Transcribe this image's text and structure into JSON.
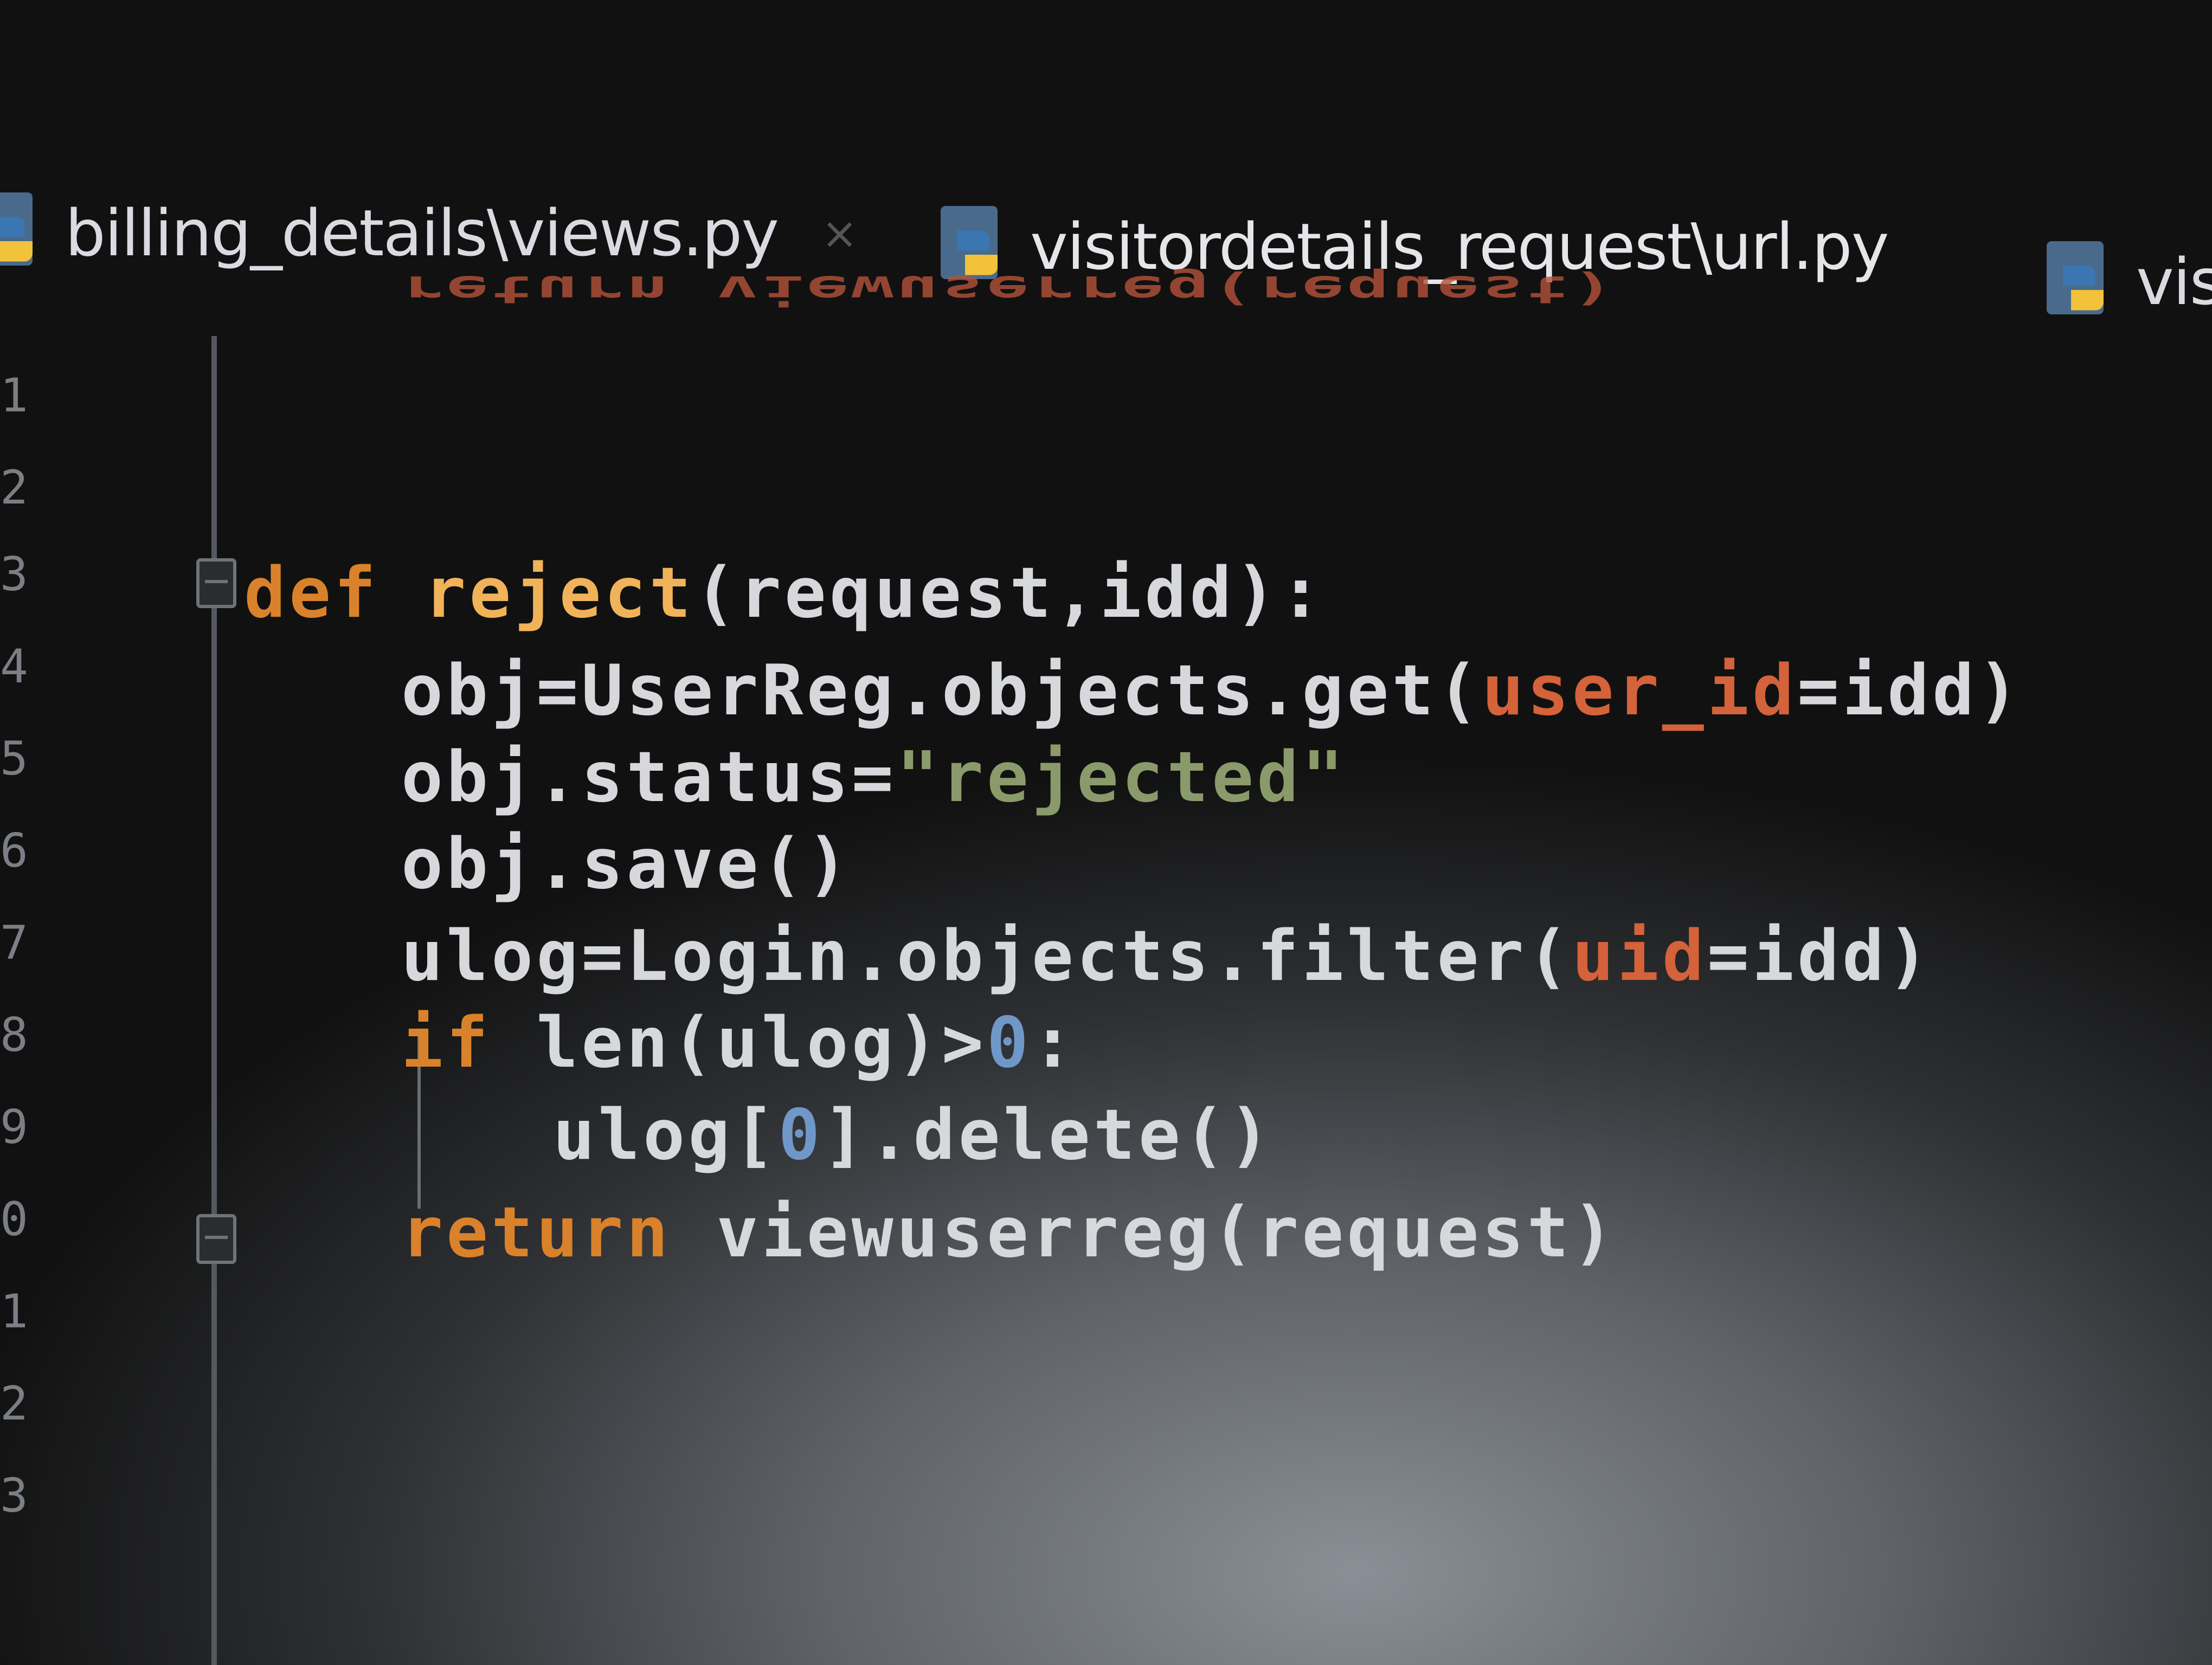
{
  "colors": {
    "keyword": "#d9822b",
    "function_name": "#f0b35a",
    "named_argument": "#d4623a",
    "string": "#8a9a6a",
    "number": "#6f98c8",
    "default_text": "#d6d8dc",
    "tab_text": "#d9dbe0"
  },
  "tabs": [
    {
      "label": "billing_details\\views.py",
      "icon": "python-file-icon",
      "close": "×"
    },
    {
      "label": "visitordetails_request\\url.py",
      "icon": "python-file-icon"
    },
    {
      "label": "vis",
      "icon": "python-file-icon"
    }
  ],
  "gutter": {
    "line_numbers": [
      "1",
      "2",
      "3",
      "4",
      "5",
      "6",
      "7",
      "8",
      "9",
      "0",
      "1",
      "2",
      "3"
    ]
  },
  "editor": {
    "ghost_line": "return viewuserreg(request)",
    "lines": [
      {
        "tokens": [
          {
            "t": "def",
            "c": "kw"
          },
          {
            "t": " ",
            "c": "plain"
          },
          {
            "t": "reject",
            "c": "fn"
          },
          {
            "t": "(request,idd):",
            "c": "plain"
          }
        ]
      },
      {
        "tokens": [
          {
            "t": "obj=UserReg.objects.get(",
            "c": "plain"
          },
          {
            "t": "user_id",
            "c": "param"
          },
          {
            "t": "=idd)",
            "c": "plain"
          }
        ]
      },
      {
        "tokens": [
          {
            "t": "obj.status=",
            "c": "plain"
          },
          {
            "t": "\"rejected\"",
            "c": "str"
          }
        ]
      },
      {
        "tokens": [
          {
            "t": "obj.save()",
            "c": "plain"
          }
        ]
      },
      {
        "tokens": [
          {
            "t": "ulog=Login.objects.filter(",
            "c": "plain"
          },
          {
            "t": "uid",
            "c": "param"
          },
          {
            "t": "=idd)",
            "c": "plain"
          }
        ]
      },
      {
        "tokens": [
          {
            "t": "if",
            "c": "kw"
          },
          {
            "t": " len(ulog)>",
            "c": "plain"
          },
          {
            "t": "0",
            "c": "num"
          },
          {
            "t": ":",
            "c": "plain"
          }
        ]
      },
      {
        "tokens": [
          {
            "t": "ulog[",
            "c": "plain"
          },
          {
            "t": "0",
            "c": "num"
          },
          {
            "t": "].delete()",
            "c": "plain"
          }
        ]
      },
      {
        "tokens": [
          {
            "t": "return",
            "c": "kw"
          },
          {
            "t": " viewuserreg(request)",
            "c": "plain"
          }
        ]
      }
    ]
  }
}
